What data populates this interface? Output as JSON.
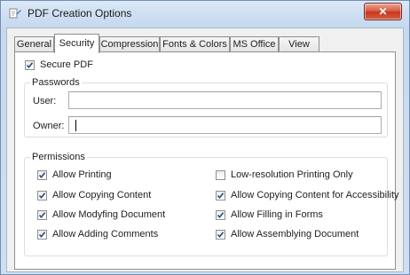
{
  "window": {
    "title": "PDF Creation Options",
    "close_glyph": "✕",
    "app_icon": "pdf-creator-icon"
  },
  "tabs": [
    {
      "label": "General",
      "active": false
    },
    {
      "label": "Security",
      "active": true
    },
    {
      "label": "Compression",
      "active": false
    },
    {
      "label": "Fonts & Colors",
      "active": false
    },
    {
      "label": "MS Office",
      "active": false
    },
    {
      "label": "View",
      "active": false
    }
  ],
  "security": {
    "secure_pdf": {
      "label": "Secure PDF",
      "checked": true
    },
    "passwords": {
      "legend": "Passwords",
      "user_label": "User:",
      "user_value": "",
      "owner_label": "Owner:",
      "owner_value": ""
    },
    "permissions": {
      "legend": "Permissions",
      "items": [
        {
          "label": "Allow Printing",
          "checked": true
        },
        {
          "label": "Low-resolution Printing Only",
          "checked": false
        },
        {
          "label": "Allow Copying Content",
          "checked": true
        },
        {
          "label": "Allow Copying Content for Accessibility",
          "checked": true
        },
        {
          "label": "Allow Modyfing Document",
          "checked": true
        },
        {
          "label": "Allow Filling in Forms",
          "checked": true
        },
        {
          "label": "Allow Adding Comments",
          "checked": true
        },
        {
          "label": "Allow Assemblying Document",
          "checked": true
        }
      ]
    }
  },
  "colors": {
    "titlebar": "#c6d9ef",
    "close_button": "#c4371f",
    "panel_border": "#8e8f8f",
    "group_border": "#d5dfe5"
  }
}
